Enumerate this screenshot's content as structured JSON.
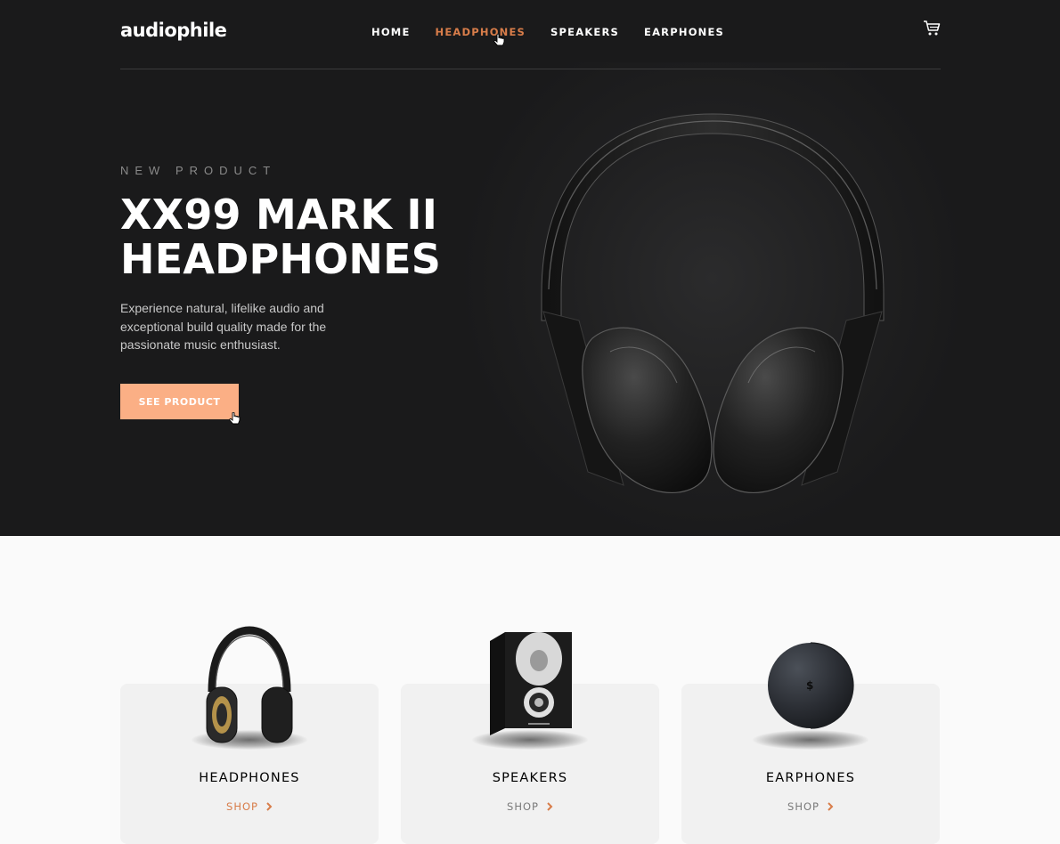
{
  "brand": {
    "logo": "audiophile"
  },
  "nav": {
    "items": [
      {
        "label": "HOME",
        "active": false
      },
      {
        "label": "HEADPHONES",
        "active": true
      },
      {
        "label": "SPEAKERS",
        "active": false
      },
      {
        "label": "EARPHONES",
        "active": false
      }
    ],
    "cart_icon": "cart-icon"
  },
  "hero": {
    "overline": "NEW PRODUCT",
    "title_line1": "XX99 MARK II",
    "title_line2": "HEADPHONES",
    "description": "Experience natural, lifelike audio and exceptional build quality made for the passionate music enthusiast.",
    "cta_label": "SEE PRODUCT"
  },
  "categories": [
    {
      "title": "HEADPHONES",
      "shop_label": "SHOP",
      "active": true
    },
    {
      "title": "SPEAKERS",
      "shop_label": "SHOP",
      "active": false
    },
    {
      "title": "EARPHONES",
      "shop_label": "SHOP",
      "active": false
    }
  ],
  "colors": {
    "accent": "#d87d4a",
    "accent_light": "#fbaf85",
    "hero_bg": "#1a1a1b",
    "page_bg": "#fafafa",
    "card_bg": "#f1f1f1"
  }
}
